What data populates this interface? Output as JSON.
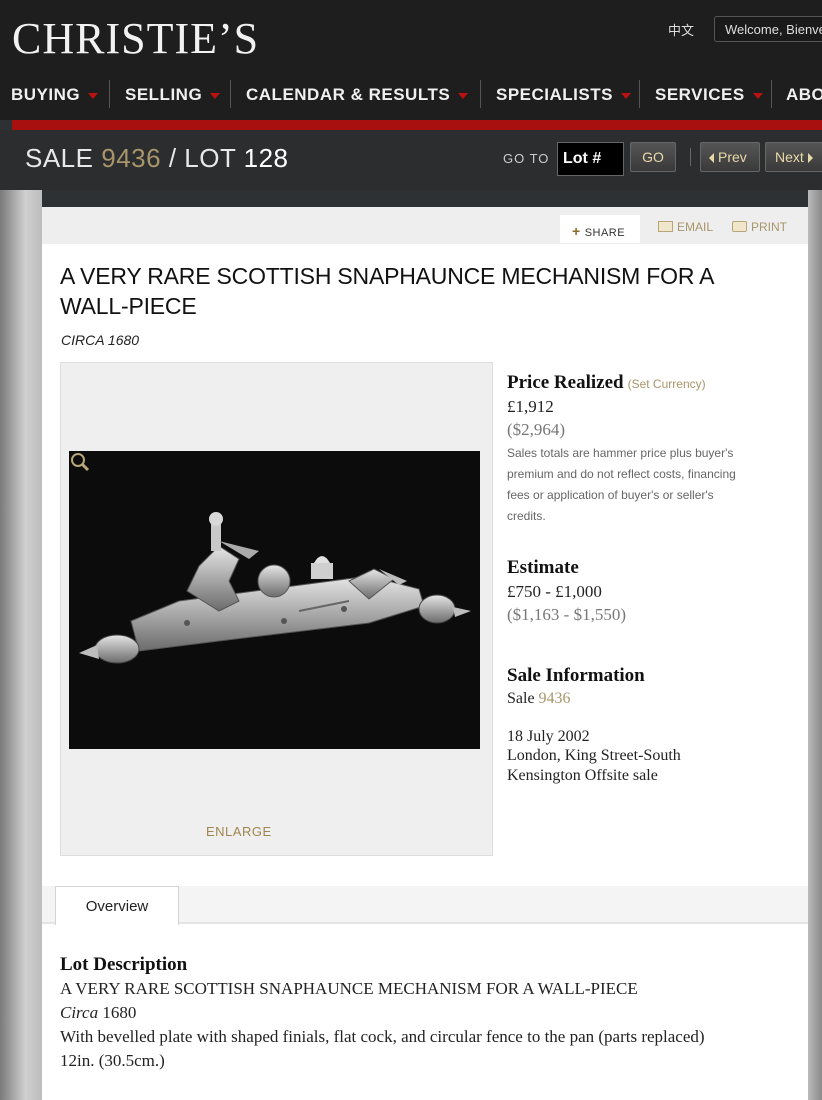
{
  "header": {
    "logo": "CHRISTIE’S",
    "language_link": "中文",
    "welcome_text": "Welcome, Bienvenue"
  },
  "nav": {
    "items": [
      {
        "label": "BUYING"
      },
      {
        "label": "SELLING"
      },
      {
        "label": "CALENDAR & RESULTS"
      },
      {
        "label": "SPECIALISTS"
      },
      {
        "label": "SERVICES"
      },
      {
        "label": "ABOUT"
      }
    ]
  },
  "sale_header": {
    "sale_label": "SALE",
    "sale_number": "9436",
    "separator": "/",
    "lot_label": "LOT",
    "lot_number": "128",
    "goto_label": "GO TO",
    "lot_input_placeholder": "Lot #",
    "go_button": "GO",
    "prev_button": "Prev",
    "next_button": "Next"
  },
  "toolbar": {
    "share": "SHARE",
    "email": "EMAIL",
    "print": "PRINT"
  },
  "lot": {
    "title": "A VERY RARE SCOTTISH SNAPHAUNCE MECHANISM FOR A WALL-PIECE",
    "date": "CIRCA 1680",
    "enlarge": "ENLARGE"
  },
  "price": {
    "heading": "Price Realized",
    "set_currency": "(Set Currency)",
    "gbp": "£1,912",
    "usd": "($2,964)",
    "note": "Sales totals are hammer price plus buyer's premium and do not reflect costs, financing fees or application of buyer's or seller's credits."
  },
  "estimate": {
    "heading": "Estimate",
    "gbp": "£750 - £1,000",
    "usd": "($1,163 - $1,550)"
  },
  "sale_info": {
    "heading": "Sale Information",
    "sale_label": "Sale",
    "sale_number": "9436",
    "date": "18 July 2002",
    "location": "London, King Street-South Kensington Offsite sale"
  },
  "tabs": {
    "overview": "Overview"
  },
  "description": {
    "heading": "Lot Description",
    "title_line": "A VERY RARE SCOTTISH SNAPHAUNCE MECHANISM FOR A WALL-PIECE",
    "circa_word": "Circa",
    "circa_year": "1680",
    "body": "With bevelled plate with shaped finials, flat cock, and circular fence to the pan (parts replaced)",
    "size": "12in. (30.5cm.)"
  }
}
